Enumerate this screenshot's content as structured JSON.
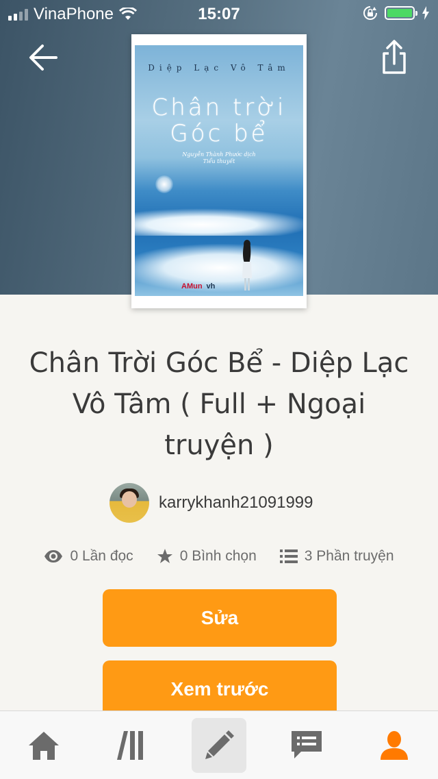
{
  "status_bar": {
    "carrier": "VinaPhone",
    "time": "15:07",
    "battery_level": 1.0
  },
  "cover": {
    "author_line": "Diệp  Lạc  Vô  Tâm",
    "title_line1": "Chân trời",
    "title_line2": "Góc bể",
    "translator": "Nguyễn Thành Phước dịch",
    "genre": "Tiểu thuyết",
    "publisher_logo": "AMun",
    "publisher_logo2": "vh"
  },
  "book": {
    "title": "Chân Trời Góc Bể - Diệp Lạc Vô Tâm ( Full + Ngoại truyện )",
    "author": "karrykhanh21091999"
  },
  "stats": {
    "reads": "0 Lần đọc",
    "votes": "0 Bình chọn",
    "parts": "3 Phần truyện"
  },
  "actions": {
    "edit_label": "Sửa",
    "preview_label": "Xem trước"
  },
  "tabs": [
    {
      "icon": "home-icon"
    },
    {
      "icon": "library-icon"
    },
    {
      "icon": "pencil-icon",
      "selected": true
    },
    {
      "icon": "messages-icon"
    },
    {
      "icon": "profile-icon",
      "active": true
    }
  ],
  "colors": {
    "accent": "#ff9a14",
    "header_bg": "#4f6879",
    "page_bg": "#f6f5f1",
    "tab_icon": "#6b6b6b"
  }
}
